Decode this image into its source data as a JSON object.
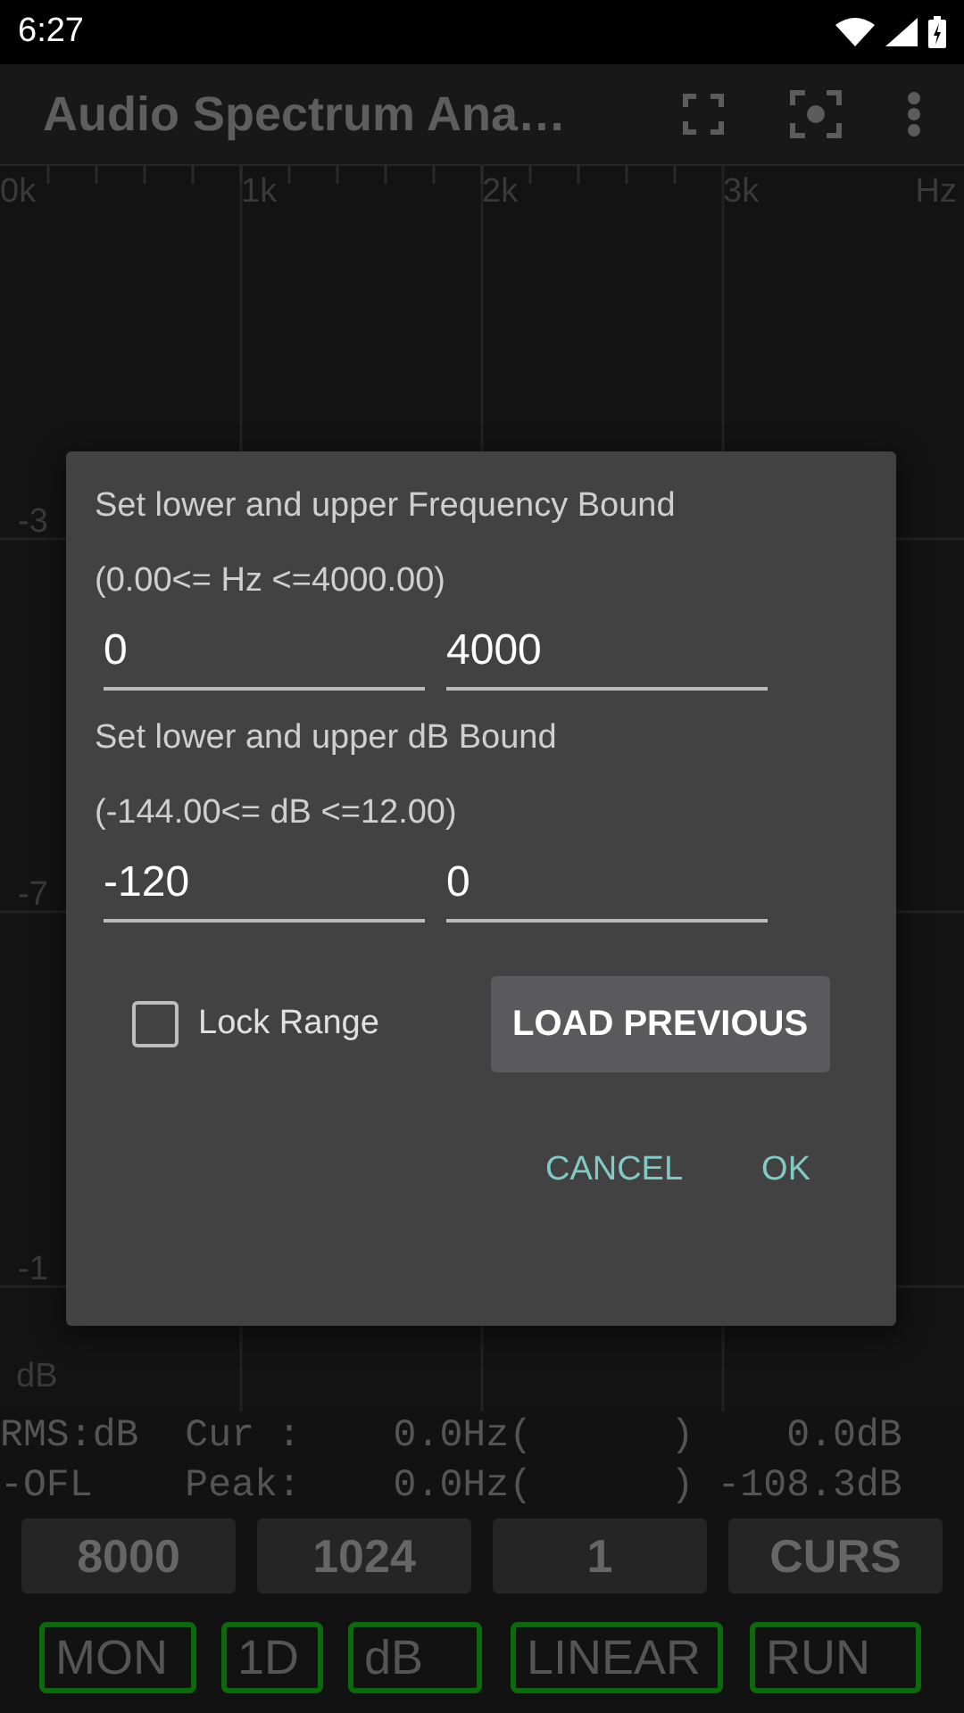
{
  "status_bar": {
    "time": "6:27"
  },
  "app_bar": {
    "title": "Audio Spectrum Ana…"
  },
  "spectrum": {
    "x_labels": [
      "0k",
      "1k",
      "2k",
      "3k",
      "Hz"
    ],
    "y_labels": [
      "-3",
      "-7",
      "-1"
    ],
    "y_unit": "dB"
  },
  "dialog": {
    "sections": [
      {
        "title": "Set lower and upper Frequency Bound",
        "range": "(0.00<= Hz <=4000.00)",
        "fields": [
          {
            "value": "0"
          },
          {
            "value": "4000"
          }
        ]
      },
      {
        "title": "Set lower and upper dB Bound",
        "range": "(-144.00<= dB <=12.00)",
        "fields": [
          {
            "value": "-120"
          },
          {
            "value": "0"
          }
        ]
      }
    ],
    "lock_range": {
      "label": "Lock Range",
      "checked": false
    },
    "load_button": "LOAD PREVIOUS",
    "actions": [
      "CANCEL",
      "OK"
    ]
  },
  "readout": [
    "RMS:dB  Cur :    0.0Hz(      )    0.0dB",
    "-OFL    Peak:    0.0Hz(      ) -108.3dB"
  ],
  "settings_buttons": [
    "8000",
    "1024",
    "1",
    "CURS"
  ],
  "mode_buttons": [
    "MON",
    "1D",
    "dB",
    "LINEAR",
    "RUN"
  ]
}
